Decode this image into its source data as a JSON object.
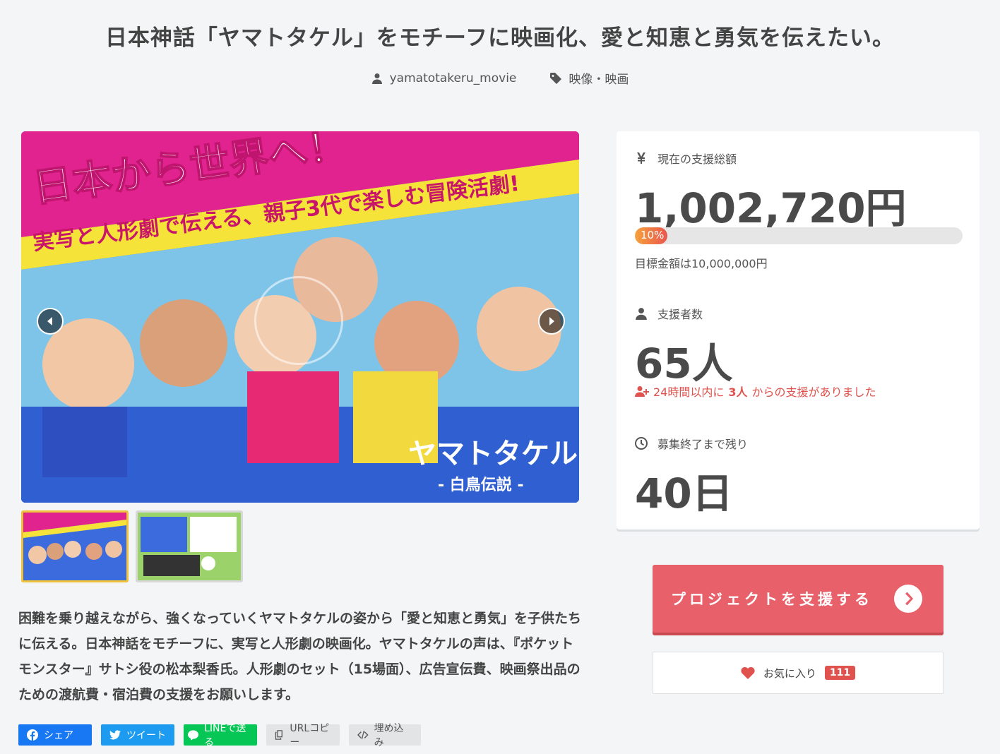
{
  "project": {
    "title": "日本神話「ヤマトタケル」をモチーフに映画化、愛と知恵と勇気を伝えたい。",
    "owner": "yamatotakeru_movie",
    "category": "映像・映画"
  },
  "hero": {
    "banner_line1": "日本から世界へ！",
    "banner_line2": "実写と人形劇で伝える、親子3代で楽しむ冒険活劇!",
    "logo_title": "ヤマトタケル",
    "logo_subtitle": "- 白鳥伝説 -"
  },
  "description": "困難を乗り越えながら、強くなっていくヤマトタケルの姿から「愛と知恵と勇気」を子供たちに伝える。日本神話をモチーフに、実写と人形劇の映画化。ヤマトタケルの声は、『ポケットモンスター』サトシ役の松本梨香氏。人形劇のセット（15場面）、広告宣伝費、映画祭出品のための渡航費・宿泊費の支援をお願いします。",
  "share": {
    "facebook": "シェア",
    "twitter": "ツイート",
    "line": "LINEで送る",
    "copy": "URLコピー",
    "embed": "埋め込み"
  },
  "stats": {
    "total_label": "現在の支援総額",
    "total_value": "1,002,720円",
    "progress_percent": 10,
    "progress_text": "10%",
    "goal_text": "目標金額は10,000,000円",
    "backers_label": "支援者数",
    "backers_value": "65人",
    "recent_prefix": "24時間以内に",
    "recent_count": "3人",
    "recent_suffix": "からの支援がありました",
    "remaining_label": "募集終了まで残り",
    "remaining_value": "40日"
  },
  "actions": {
    "support_label": "プロジェクトを支援する",
    "favorite_label": "お気に入り",
    "favorite_count": "111"
  },
  "colors": {
    "accent": "#e8616a",
    "progress_start": "#f7a13b",
    "progress_end": "#e8564f",
    "alert": "#e0524d"
  }
}
